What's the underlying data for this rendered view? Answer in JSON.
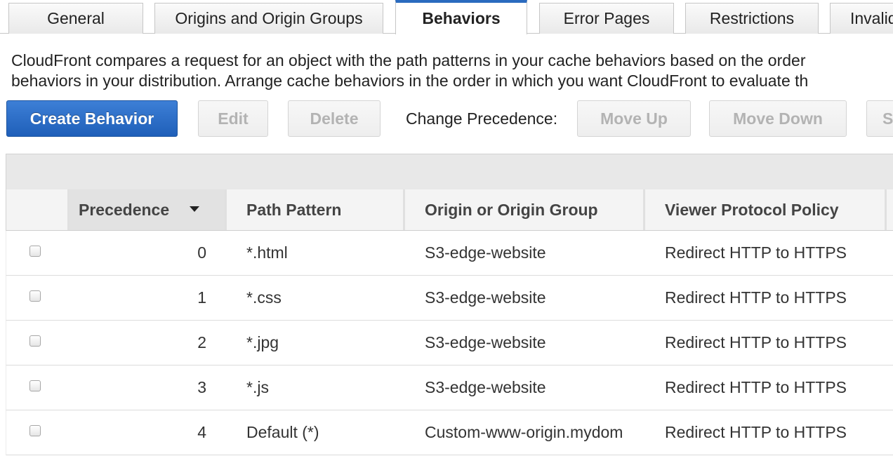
{
  "tabs": [
    {
      "label": "General"
    },
    {
      "label": "Origins and Origin Groups"
    },
    {
      "label": "Behaviors"
    },
    {
      "label": "Error Pages"
    },
    {
      "label": "Restrictions"
    },
    {
      "label": "Invalid"
    }
  ],
  "description": {
    "line1": "CloudFront compares a request for an object with the path patterns in your cache behaviors based on the order",
    "line2": "behaviors in your distribution. Arrange cache behaviors in the order in which you want CloudFront to evaluate th"
  },
  "toolbar": {
    "create_label": "Create Behavior",
    "edit_label": "Edit",
    "delete_label": "Delete",
    "precedence_label": "Change Precedence:",
    "move_up_label": "Move Up",
    "move_down_label": "Move Down",
    "save_partial_label": "S"
  },
  "table": {
    "columns": [
      {
        "label": "Precedence"
      },
      {
        "label": "Path Pattern"
      },
      {
        "label": "Origin or Origin Group"
      },
      {
        "label": "Viewer Protocol Policy"
      }
    ],
    "rows": [
      {
        "precedence": "0",
        "path": "*.html",
        "origin": "S3-edge-website",
        "policy": "Redirect HTTP to HTTPS"
      },
      {
        "precedence": "1",
        "path": "*.css",
        "origin": "S3-edge-website",
        "policy": "Redirect HTTP to HTTPS"
      },
      {
        "precedence": "2",
        "path": "*.jpg",
        "origin": "S3-edge-website",
        "policy": "Redirect HTTP to HTTPS"
      },
      {
        "precedence": "3",
        "path": "*.js",
        "origin": "S3-edge-website",
        "policy": "Redirect HTTP to HTTPS"
      },
      {
        "precedence": "4",
        "path": "Default (*)",
        "origin": "Custom-www-origin.mydom",
        "policy": "Redirect HTTP to HTTPS"
      }
    ]
  },
  "colors": {
    "accent": "#2b6bbf",
    "primary_button": "#2a6ac6"
  }
}
